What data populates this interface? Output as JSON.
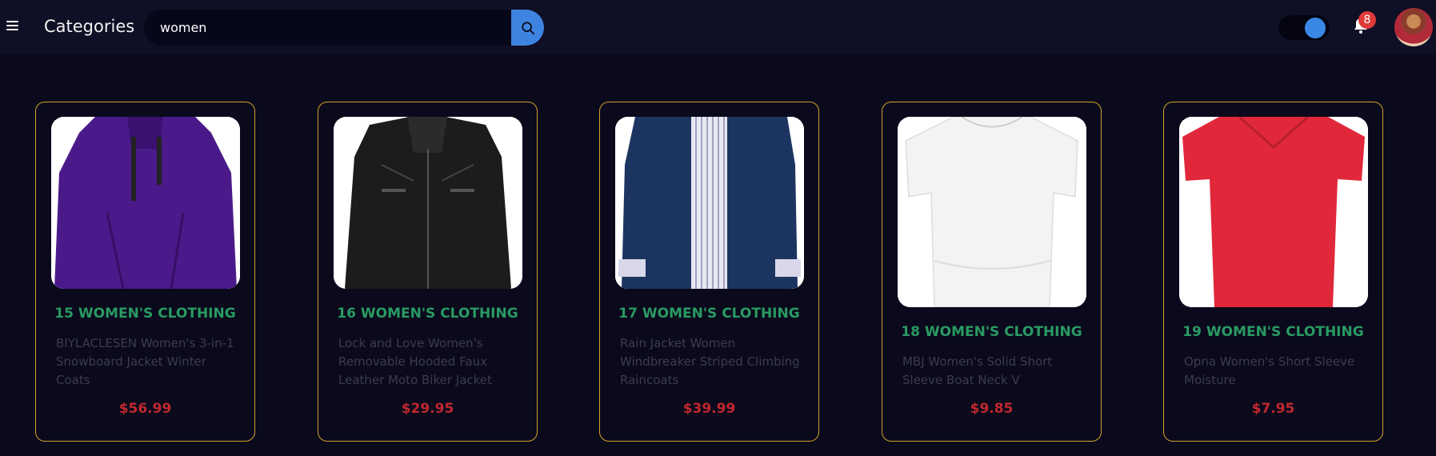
{
  "header": {
    "brand": "Categories",
    "search_value": "women",
    "notification_count": "8",
    "menu_icon": "hamburger-icon",
    "search_icon": "search-icon",
    "bell_icon": "bell-icon",
    "accent_color": "#3d84e0"
  },
  "products": [
    {
      "category": "15 WOMEN'S CLOTHING",
      "name": "BIYLACLESEN Women's 3-in-1 Snowboard Jacket Winter Coats",
      "price": "$56.99",
      "image": "purple-jacket"
    },
    {
      "category": "16 WOMEN'S CLOTHING",
      "name": "Lock and Love Women's Removable Hooded Faux Leather Moto Biker Jacket",
      "price": "$29.95",
      "image": "black-leather-jacket"
    },
    {
      "category": "17 WOMEN'S CLOTHING",
      "name": "Rain Jacket Women Windbreaker Striped Climbing Raincoats",
      "price": "$39.99",
      "image": "navy-raincoat"
    },
    {
      "category": "18 WOMEN'S CLOTHING",
      "name": "MBJ Women's Solid Short Sleeve Boat Neck V",
      "price": "$9.85",
      "image": "white-top"
    },
    {
      "category": "19 WOMEN'S CLOTHING",
      "name": "Opna Women's Short Sleeve Moisture",
      "price": "$7.95",
      "image": "red-tshirt"
    }
  ],
  "colors": {
    "card_border": "#d8a22a",
    "category_text": "#2a9a63",
    "price_text": "#c0282e"
  }
}
